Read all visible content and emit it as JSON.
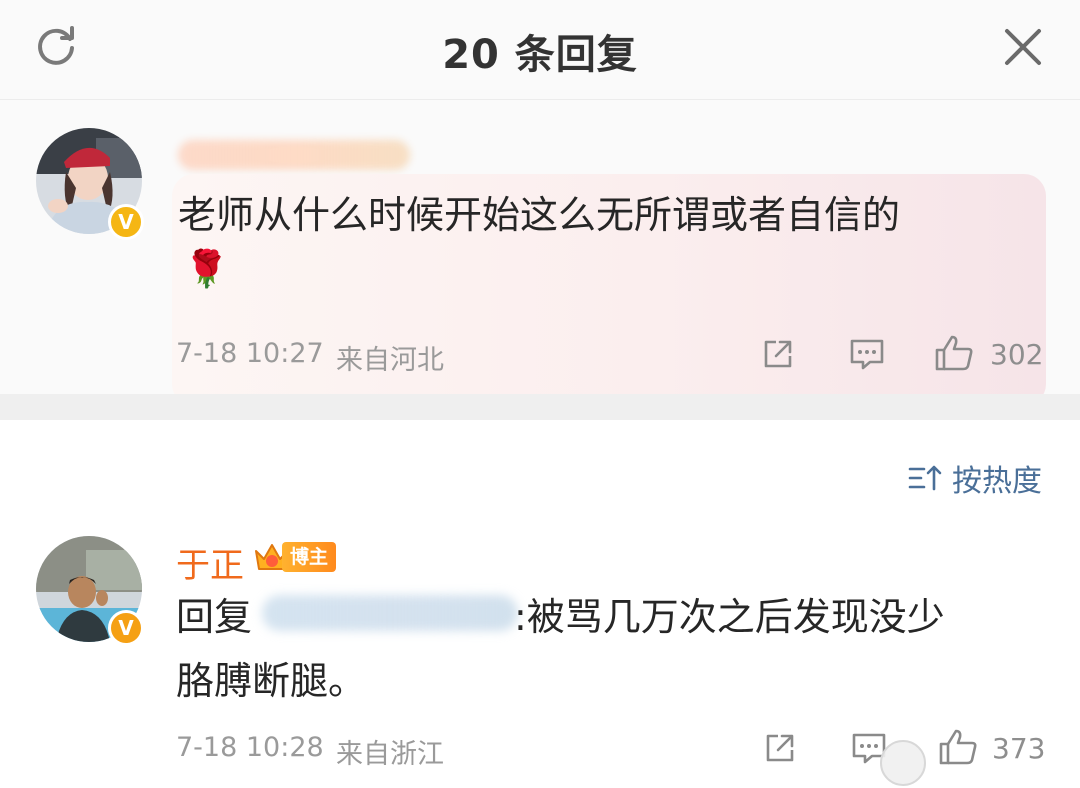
{
  "header": {
    "title": "20 条回复",
    "refresh_icon": "refresh-icon",
    "close_icon": "close-icon"
  },
  "comment1": {
    "text_line1": "老师从什么时候开始这么无所谓或者自信的",
    "emoji": "🌹",
    "time": "7-18 10:27",
    "location": "来自河北",
    "likes": "302",
    "verified_badge": "V",
    "badge_color": "#f5b614"
  },
  "sort": {
    "label": "按热度",
    "icon": "sort-icon"
  },
  "comment2": {
    "author": "于正",
    "author_tag": "博主",
    "reply_prefix": "回复",
    "reply_body_line1": ":被骂几万次之后发现没少",
    "reply_body_line2": "胳膊断腿。",
    "time": "7-18 10:28",
    "location": "来自浙江",
    "likes": "373",
    "verified_badge": "V",
    "badge_color": "#f5a014"
  },
  "colors": {
    "author_name": "#f06a1c",
    "link_blue": "#4a6f98",
    "meta_gray": "#9a9a9a"
  }
}
